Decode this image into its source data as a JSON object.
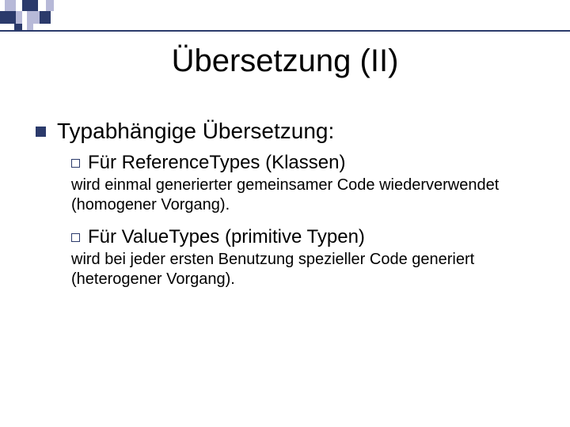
{
  "slide": {
    "title": "Übersetzung (II)",
    "section": {
      "heading": "Typabhängige Übersetzung:",
      "items": [
        {
          "lead": "Für ReferenceTypes (Klassen)",
          "body": "wird einmal generierter gemeinsamer Code wiederverwendet (homogener Vorgang)."
        },
        {
          "lead": "Für ValueTypes (primitive Typen)",
          "body": "wird bei jeder ersten Benutzung spezieller Code generiert (heterogener Vorgang)."
        }
      ]
    }
  },
  "theme": {
    "accent": "#2b3a6b",
    "accent_light": "#b7b9d8"
  }
}
